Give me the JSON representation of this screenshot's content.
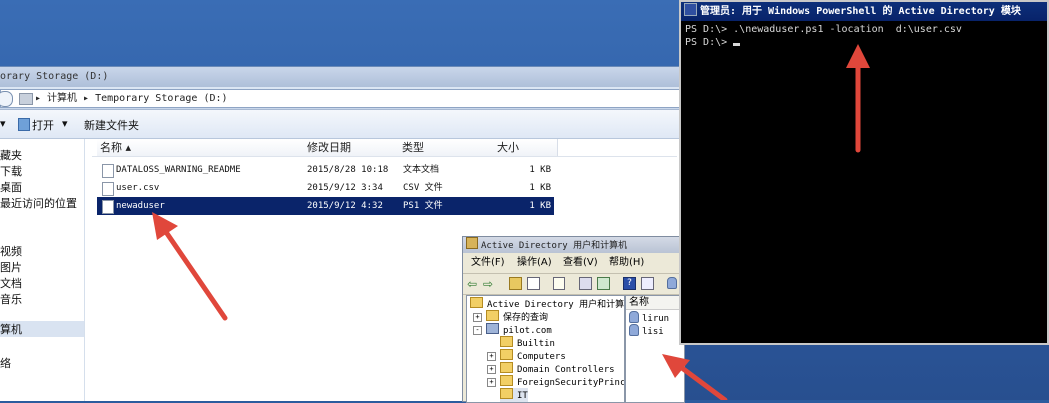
{
  "explorer": {
    "title": "orary Storage (D:)",
    "address_path": "▸ 计算机 ▸ Temporary Storage (D:)",
    "toolbar": {
      "open_label": "打开",
      "new_folder_label": "新建文件夹"
    },
    "sidebar": [
      "藏夹",
      "下载",
      "桌面",
      "最近访问的位置",
      "视频",
      "图片",
      "文档",
      "音乐",
      "算机",
      "络"
    ],
    "columns": [
      "名称",
      "修改日期",
      "类型",
      "大小"
    ],
    "files": [
      {
        "name": "DATALOSS_WARNING_README",
        "date": "2015/8/28 10:18",
        "type": "文本文档",
        "size": "1 KB"
      },
      {
        "name": "user.csv",
        "date": "2015/9/12 3:34",
        "type": "CSV 文件",
        "size": "1 KB"
      },
      {
        "name": "newaduser",
        "date": "2015/9/12 4:32",
        "type": "PS1 文件",
        "size": "1 KB",
        "selected": true
      }
    ]
  },
  "ad_window": {
    "title": "Active Directory 用户和计算机",
    "menu": [
      "文件(F)",
      "操作(A)",
      "查看(V)",
      "帮助(H)"
    ],
    "tree": [
      {
        "label": "Active Directory 用户和计算机",
        "level": 0,
        "expander": ""
      },
      {
        "label": "保存的查询",
        "level": 1,
        "expander": "+"
      },
      {
        "label": "pilot.com",
        "level": 1,
        "expander": "-"
      },
      {
        "label": "Builtin",
        "level": 2,
        "expander": ""
      },
      {
        "label": "Computers",
        "level": 2,
        "expander": "+"
      },
      {
        "label": "Domain Controllers",
        "level": 2,
        "expander": "+"
      },
      {
        "label": "ForeignSecurityPrincip",
        "level": 2,
        "expander": "+"
      },
      {
        "label": "IT",
        "level": 2,
        "expander": ""
      }
    ],
    "list_header": "名称",
    "list_items": [
      "lirun",
      "lisi"
    ]
  },
  "powershell": {
    "title": "管理员: 用于 Windows PowerShell 的 Active Directory 模块",
    "lines": [
      "PS D:\\> .\\newaduser.ps1 -location  d:\\user.csv",
      "PS D:\\> "
    ]
  },
  "colors": {
    "arrow": "#e0473b",
    "selection": "#0a246a",
    "console_bg": "#000000"
  }
}
